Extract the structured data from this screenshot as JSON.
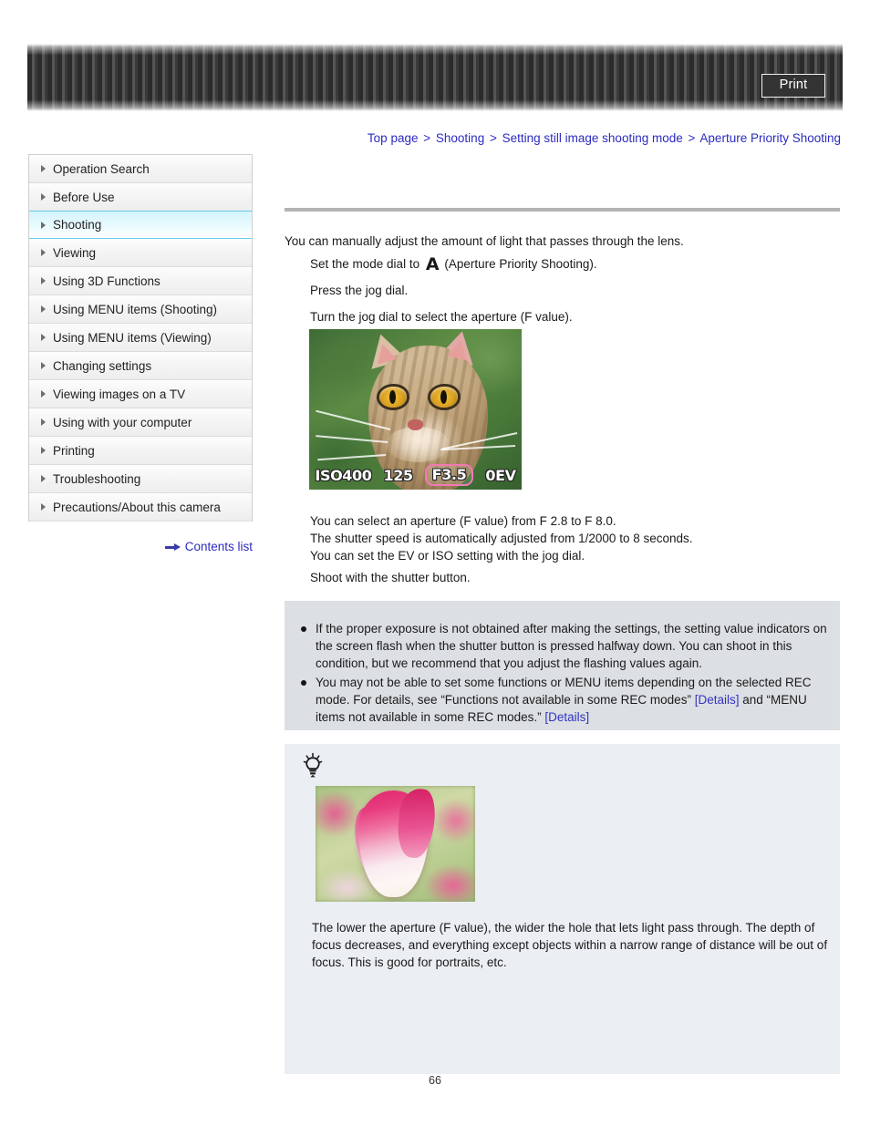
{
  "header": {
    "print_label": "Print",
    "print_icon": "print-icon"
  },
  "breadcrumb": {
    "items": [
      "Top page",
      "Shooting",
      "Setting still image shooting mode",
      "Aperture Priority Shooting"
    ],
    "separator": ">"
  },
  "sidebar": {
    "items": [
      {
        "label": "Operation Search",
        "active": false
      },
      {
        "label": "Before Use",
        "active": false
      },
      {
        "label": "Shooting",
        "active": true
      },
      {
        "label": "Viewing",
        "active": false
      },
      {
        "label": "Using 3D Functions",
        "active": false
      },
      {
        "label": "Using MENU items (Shooting)",
        "active": false
      },
      {
        "label": "Using MENU items (Viewing)",
        "active": false
      },
      {
        "label": "Changing settings",
        "active": false
      },
      {
        "label": "Viewing images on a TV",
        "active": false
      },
      {
        "label": "Using with your computer",
        "active": false
      },
      {
        "label": "Printing",
        "active": false
      },
      {
        "label": "Troubleshooting",
        "active": false
      },
      {
        "label": "Precautions/About this camera",
        "active": false
      }
    ],
    "contents_link": "Contents list"
  },
  "main": {
    "intro": "You can manually adjust the amount of light that passes through the lens.",
    "step1_pre": "Set the mode dial to",
    "step1_mode": "A",
    "step1_post": "(Aperture Priority Shooting).",
    "step2": "Press the jog dial.",
    "step3": "Turn the jog dial to select the aperture (F value).",
    "camera_screen": {
      "iso": "ISO400",
      "shutter": "125",
      "aperture": "F3.5",
      "ev": "0EV",
      "aperture_highlight_color": "#f07ab4"
    },
    "after_lines": [
      "You can select an aperture (F value) from F 2.8 to F 8.0.",
      "The shutter speed is automatically adjusted from 1/2000 to 8 seconds.",
      "You can set the EV or ISO setting with the jog dial."
    ],
    "step4": "Shoot with the shutter button."
  },
  "note_box": {
    "bullets": [
      {
        "text_1": "If the proper exposure is not obtained after making the settings, the setting value indicators on the screen flash when the shutter button is pressed halfway down. You can shoot in this condition, but we recommend that you adjust the flashing values again."
      },
      {
        "text_1": "You may not be able to set some functions or MENU items depending on the selected REC mode. For details, see “Functions not available in some REC modes” ",
        "link_1": "[Details]",
        "text_2": " and “MENU items not available in some REC modes.” ",
        "link_2": "[Details]"
      }
    ]
  },
  "tip_box": {
    "icon": "lightbulb-icon",
    "text": "The lower the aperture (F value), the wider the hole that lets light pass through. The depth of focus decreases, and everything except objects within a narrow range of distance will be out of focus. This is good for portraits, etc."
  },
  "footer": {
    "page_number": "66"
  },
  "colors": {
    "link": "#2b2bc0",
    "sidebar_active": "#d4f4fb",
    "note_bg": "#dcdfe3",
    "tip_bg": "#ebeef2"
  }
}
